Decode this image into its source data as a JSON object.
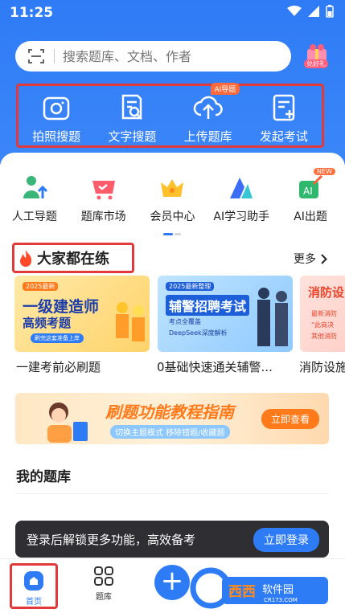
{
  "status": {
    "time": "11:25"
  },
  "search": {
    "placeholder": "搜索题库、文档、作者",
    "gift_label": "兑好礼"
  },
  "quick_actions": [
    {
      "label": "拍照搜题",
      "icon": "camera-icon"
    },
    {
      "label": "文字搜题",
      "icon": "document-search-icon"
    },
    {
      "label": "上传题库",
      "icon": "cloud-upload-icon",
      "badge": "AI导题"
    },
    {
      "label": "发起考试",
      "icon": "exam-add-icon"
    }
  ],
  "tools": [
    {
      "label": "人工导题",
      "icon": "person-upload-icon"
    },
    {
      "label": "题库市场",
      "icon": "cart-icon"
    },
    {
      "label": "会员中心",
      "icon": "crown-icon"
    },
    {
      "label": "AI学习助手",
      "icon": "ai-assistant-icon"
    },
    {
      "label": "AI出题",
      "icon": "ai-question-icon",
      "badge": "NEW"
    }
  ],
  "section": {
    "title": "大家都在练",
    "more": "更多"
  },
  "banners": [
    {
      "tag": "2025最新",
      "line1": "一级建造师",
      "line2": "高频考题",
      "pill": "刷完这套准备上岸",
      "title": "一建考前必刷题"
    },
    {
      "tag": "2025最新整理",
      "line1": "辅警招聘考试",
      "bullet1": "考点全覆盖",
      "bullet2": "DeepSeek深度解析",
      "title": "0基础快速通关辅警..."
    },
    {
      "line1": "消防设",
      "bullet1": "最新消防",
      "bullet2": "“此商决",
      "bullet3": "其他消防",
      "title": "消防设施"
    }
  ],
  "guide": {
    "title": "刷题功能教程指南",
    "sub1": "切换主题模式",
    "sub2": "移除错题/收藏题",
    "button": "立即查看"
  },
  "my_bank": {
    "title": "我的题库"
  },
  "toast": {
    "text": "登录后解锁更多功能，高效备考",
    "button": "立即登录"
  },
  "tabbar": {
    "home": "首页",
    "bank": "题库"
  },
  "watermark": {
    "brand": "西西",
    "text": "软件园",
    "url": "CR173.COM"
  },
  "colors": {
    "primary": "#2d7cf6",
    "highlight": "#e23a3a",
    "orange": "#ff7a1a"
  }
}
